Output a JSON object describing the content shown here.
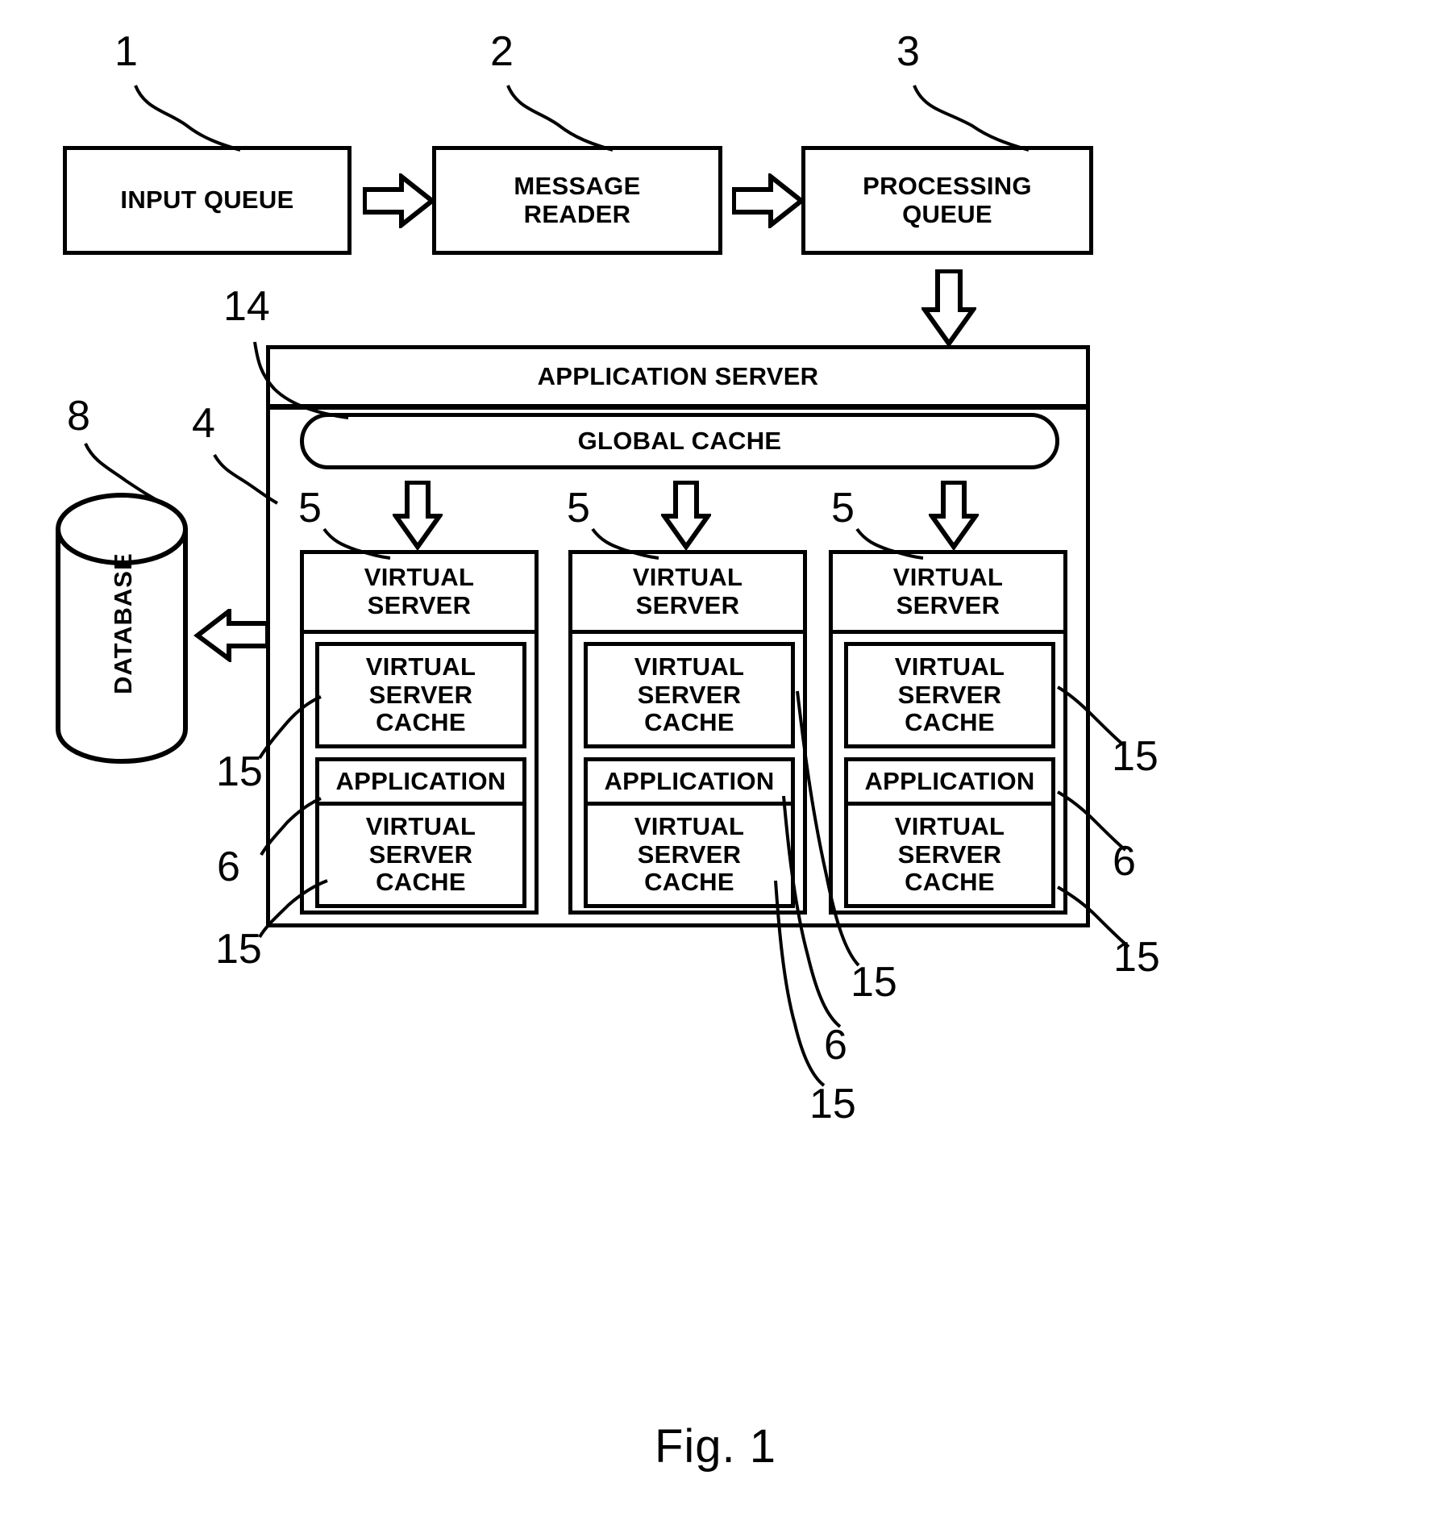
{
  "figure": {
    "caption": "Fig. 1",
    "top_boxes": [
      {
        "label": "INPUT QUEUE",
        "ref": "1"
      },
      {
        "label": "MESSAGE\nREADER",
        "ref": "2"
      },
      {
        "label": "PROCESSING\nQUEUE",
        "ref": "3"
      }
    ],
    "application_server": {
      "title": "APPLICATION SERVER",
      "ref_container": "14",
      "ref_boundary": "4",
      "global_cache": {
        "label": "GLOBAL CACHE"
      },
      "virtual_servers": [
        {
          "ref": "5",
          "header": "VIRTUAL\nSERVER",
          "cache_top": "VIRTUAL\nSERVER\nCACHE",
          "application": "APPLICATION",
          "cache_bottom": "VIRTUAL\nSERVER\nCACHE"
        },
        {
          "ref": "5",
          "header": "VIRTUAL\nSERVER",
          "cache_top": "VIRTUAL\nSERVER\nCACHE",
          "application": "APPLICATION",
          "cache_bottom": "VIRTUAL\nSERVER\nCACHE"
        },
        {
          "ref": "5",
          "header": "VIRTUAL\nSERVER",
          "cache_top": "VIRTUAL\nSERVER\nCACHE",
          "application": "APPLICATION",
          "cache_bottom": "VIRTUAL\nSERVER\nCACHE"
        }
      ]
    },
    "database": {
      "label": "DATABASE",
      "ref": "8"
    },
    "reference_numerals": {
      "left_cache_top": "15",
      "left_application": "6",
      "left_cache_bottom": "15",
      "middle_cache_top": "15",
      "middle_application": "6",
      "middle_cache_bottom": "15",
      "right_cache_top": "15",
      "right_application": "6",
      "right_cache_bottom": "15"
    }
  },
  "labels": {
    "n1": "1",
    "n2": "2",
    "n3": "3",
    "n4": "4",
    "n5a": "5",
    "n5b": "5",
    "n5c": "5",
    "n6a": "6",
    "n6b": "6",
    "n6c": "6",
    "n8": "8",
    "n14": "14",
    "n15a": "15",
    "n15b": "15",
    "n15c": "15",
    "n15d": "15",
    "n15e": "15",
    "n15f": "15"
  },
  "colors": {
    "ink": "#000000",
    "paper": "#ffffff"
  }
}
